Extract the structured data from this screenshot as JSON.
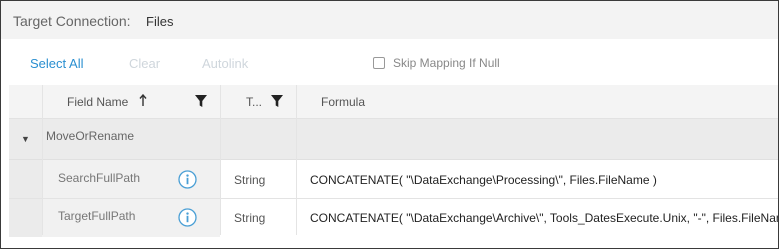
{
  "header": {
    "target_label": "Target Connection:",
    "target_value": "Files"
  },
  "toolbar": {
    "select_all": "Select All",
    "clear": "Clear",
    "autolink": "Autolink",
    "skip_mapping": "Skip Mapping If Null"
  },
  "grid": {
    "columns": {
      "field_name": "Field Name",
      "type": "T...",
      "formula": "Formula"
    },
    "group": {
      "label": "MoveOrRename"
    },
    "rows": [
      {
        "field_name": "SearchFullPath",
        "type": "String",
        "formula": "CONCATENATE( \"\\DataExchange\\Processing\\\", Files.FileName )"
      },
      {
        "field_name": "TargetFullPath",
        "type": "String",
        "formula": "CONCATENATE( \"\\DataExchange\\Archive\\\", Tools_DatesExecute.Unix, \"-\", Files.FileName ..."
      }
    ]
  },
  "colors": {
    "accent": "#2a8fd0",
    "disabled": "#cfd6dc",
    "info_icon": "#4a9fd5"
  },
  "icons": {
    "sort": "arrow-up-icon",
    "filter": "filter-icon",
    "info": "info-circle-icon",
    "group_toggle": "caret-down-icon"
  }
}
